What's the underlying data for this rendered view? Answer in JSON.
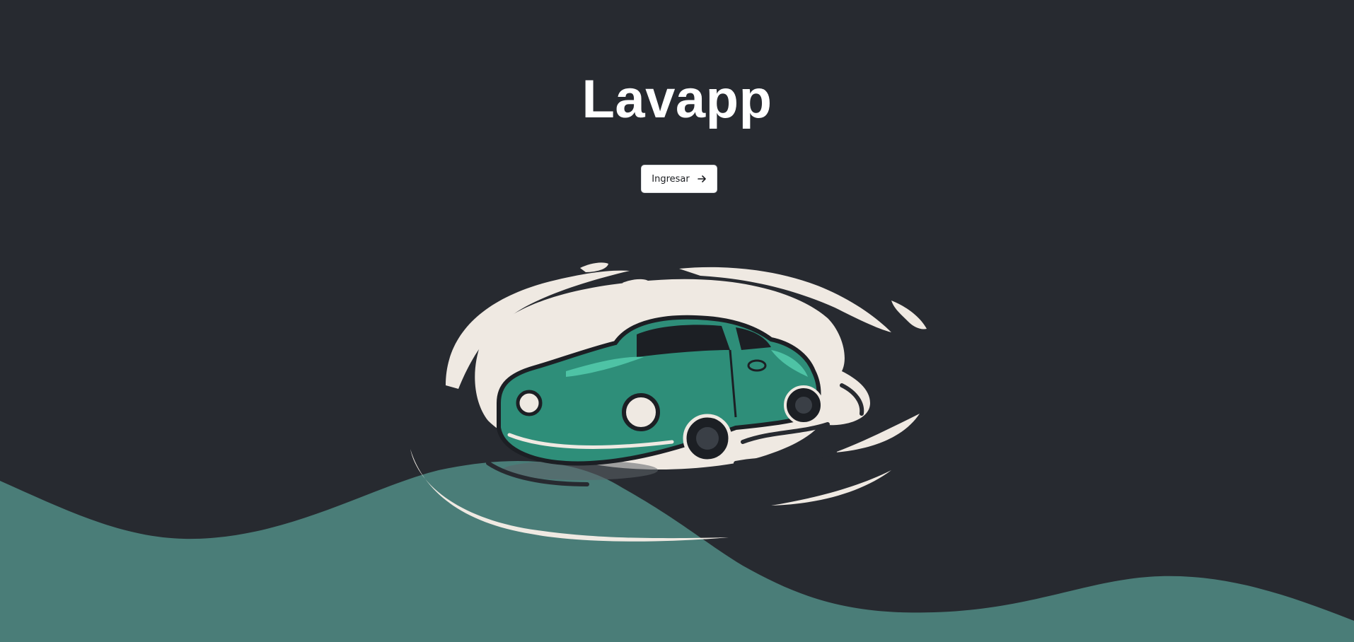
{
  "app": {
    "title": "Lavapp"
  },
  "hero": {
    "login_button_label": "Ingresar",
    "login_button_icon": "arrow-right-icon",
    "logo_icon": "car-splash-logo"
  },
  "colors": {
    "background": "#272a30",
    "wave": "#4a7d78",
    "car_body": "#2e8e79",
    "splash": "#efe9e2",
    "button_bg": "#ffffff",
    "title_text": "#ffffff"
  }
}
